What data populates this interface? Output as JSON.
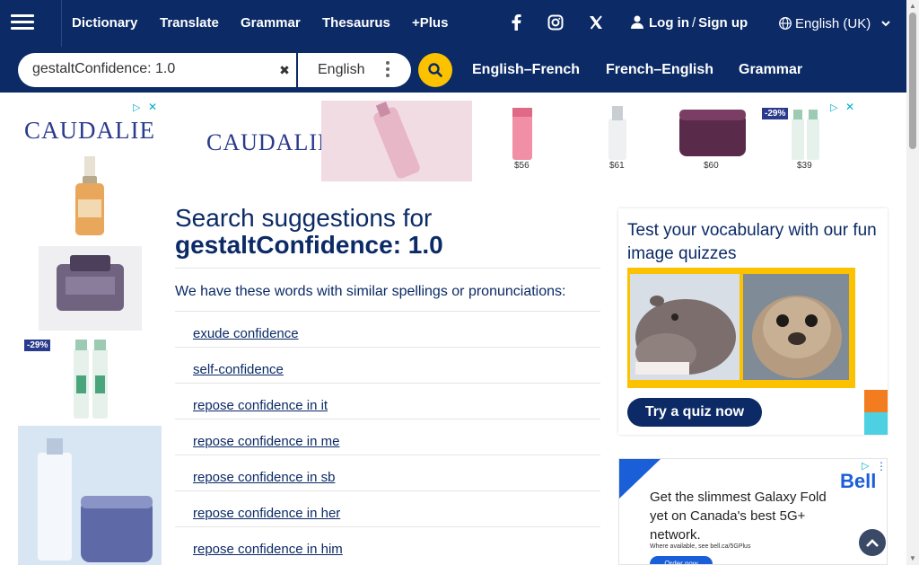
{
  "nav": {
    "links": [
      "Dictionary",
      "Translate",
      "Grammar",
      "Thesaurus",
      "+Plus"
    ],
    "login": "Log in",
    "signup": "Sign up",
    "separator": "/",
    "language": "English (UK)"
  },
  "search": {
    "value": "gestaltConfidence: 1.0",
    "dictionary": "English",
    "tabs": [
      "English–French",
      "French–English",
      "Grammar"
    ]
  },
  "main": {
    "heading_prefix": "Search suggestions for",
    "heading_term": "gestaltConfidence: 1.0",
    "intro": "We have these words with similar spellings or pronunciations:",
    "suggestions": [
      "exude confidence",
      "self-confidence",
      "repose confidence in it",
      "repose confidence in me",
      "repose confidence in sb",
      "repose confidence in her",
      "repose confidence in him"
    ]
  },
  "quiz": {
    "title": "Test your vocabulary with our fun image quizzes",
    "button": "Try a quiz now"
  },
  "ads": {
    "caudalie_brand": "CAUDALIE",
    "sale_badge": "-29%",
    "prices": [
      "$56",
      "$61",
      "$60",
      "$39"
    ],
    "bell_headline": "Get the slimmest Galaxy Fold yet on Canada's best 5G+ network.",
    "bell_sub": "Where available, see bell.ca/5GPlus",
    "bell_cta": "Order now",
    "bell_brand": "Bell"
  },
  "colors": {
    "nav_bg": "#0b2a66",
    "accent_yellow": "#fcc200",
    "text_primary": "#0b2a66"
  }
}
